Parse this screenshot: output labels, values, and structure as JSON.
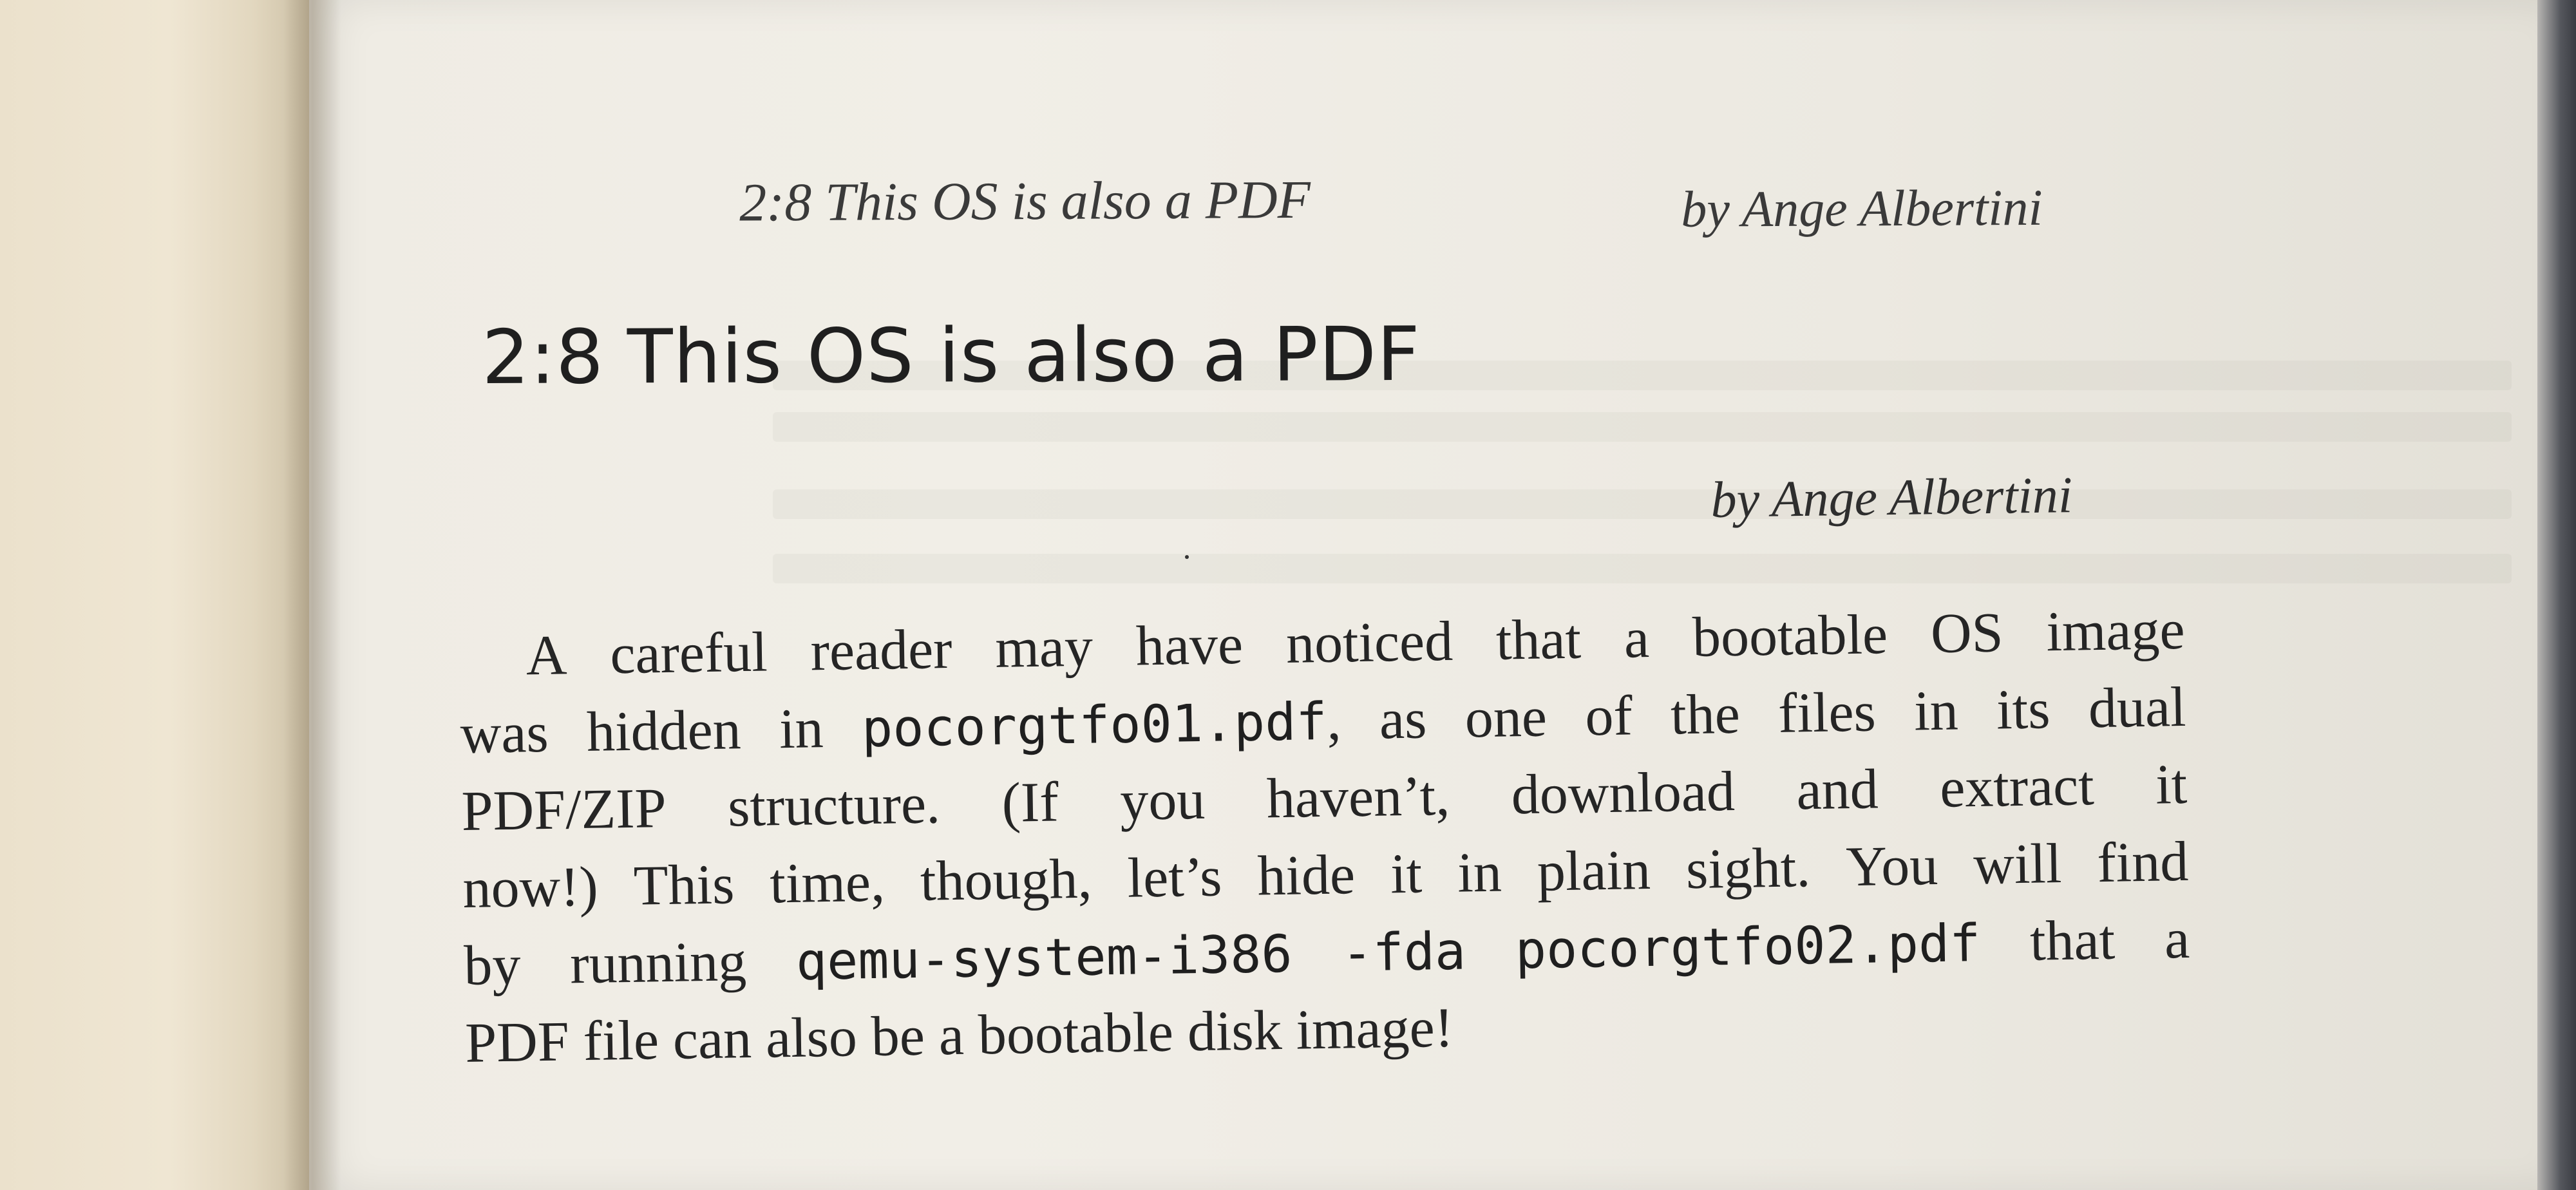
{
  "running_header": {
    "left": "2:8  This OS is also a PDF",
    "right": "by Ange Albertini"
  },
  "section": {
    "number": "2:8",
    "title": "This OS is also a PDF",
    "byline": "by Ange Albertini"
  },
  "paragraph": {
    "lines": [
      [
        "A",
        "careful",
        "reader",
        "may",
        "have",
        "noticed",
        "that",
        "a",
        "bootable",
        "OS",
        "image"
      ],
      [
        "was",
        "hidden",
        "in",
        "pocorgtfo01.pdf,",
        "as",
        "one",
        "of",
        "the",
        "files",
        "in",
        "its",
        "dual"
      ],
      [
        "PDF/ZIP",
        "structure.",
        "(If",
        "you",
        "haven’t,",
        "download",
        "and",
        "extract",
        "it"
      ],
      [
        "now!)",
        "This",
        "time,",
        "though,",
        "let’s",
        "hide",
        "it",
        "in",
        "plain",
        "sight.",
        "You",
        "will",
        "find"
      ],
      [
        "by",
        "running",
        "qemu-system-i386",
        "-fda",
        "pocorgtfo02.pdf",
        "that",
        "a"
      ],
      [
        "PDF",
        "file",
        "can",
        "also",
        "be",
        "a",
        "bootable",
        "disk",
        "image!"
      ]
    ],
    "monospace_words": [
      "pocorgtfo01.pdf",
      "qemu-system-i386",
      "-fda",
      "pocorgtfo02.pdf"
    ]
  },
  "colors": {
    "paper": "#efece4",
    "ink": "#252525",
    "left_page": "#ebe1cc"
  }
}
